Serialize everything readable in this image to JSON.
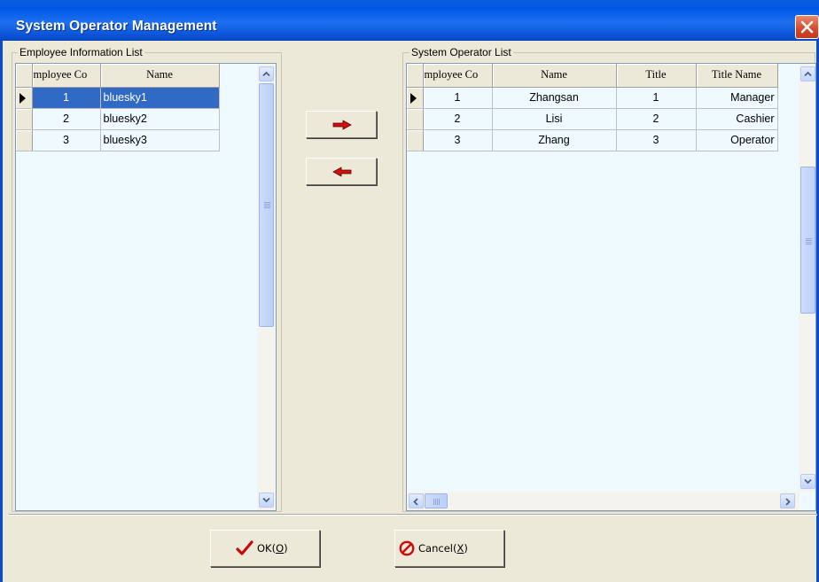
{
  "window": {
    "title": "System Operator Management"
  },
  "employee_panel": {
    "label": "Employee Information List",
    "columns": [
      "mployee Co",
      "Name"
    ],
    "rows": [
      {
        "code": "1",
        "name": "bluesky1",
        "selected": true
      },
      {
        "code": "2",
        "name": "bluesky2",
        "selected": false
      },
      {
        "code": "3",
        "name": "bluesky3",
        "selected": false
      }
    ]
  },
  "operator_panel": {
    "label": "System Operator List",
    "columns": [
      "mployee Co",
      "Name",
      "Title",
      "Title Name"
    ],
    "rows": [
      {
        "code": "1",
        "name": "Zhangsan",
        "title": "1",
        "title_name": "Manager"
      },
      {
        "code": "2",
        "name": "Lisi",
        "title": "2",
        "title_name": "Cashier"
      },
      {
        "code": "3",
        "name": "Zhang",
        "title": "3",
        "title_name": "Operator"
      }
    ]
  },
  "buttons": {
    "ok": {
      "text": "OK(",
      "key": "O",
      "end": ")"
    },
    "cancel": {
      "text": "Cancel(",
      "key": "X",
      "end": ")"
    }
  },
  "icons": {
    "move_right": "red-arrow-right-icon",
    "move_left": "red-arrow-left-icon",
    "ok": "red-checkmark-icon",
    "cancel": "red-no-entry-icon"
  }
}
